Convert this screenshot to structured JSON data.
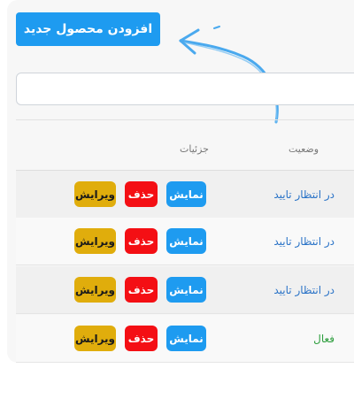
{
  "colors": {
    "primary": "#1e9bf0",
    "danger": "#f40f14",
    "warning": "#e0ad0c",
    "link": "#2a73c7",
    "success": "#2e9e3e",
    "arrow": "#4aa9ee"
  },
  "toolbar": {
    "add_label": "افزودن محصول جدید"
  },
  "search": {
    "value": "",
    "placeholder": ""
  },
  "table": {
    "headers": {
      "status": "وضعیت",
      "details": "جزئیات"
    },
    "rows": [
      {
        "status": "در انتظار تایید",
        "status_color": "#2a73c7",
        "view": "نمایش",
        "delete": "حذف",
        "edit": "ویرایش"
      },
      {
        "status": "در انتظار تایید",
        "status_color": "#2a73c7",
        "view": "نمایش",
        "delete": "حذف",
        "edit": "ویرایش"
      },
      {
        "status": "در انتظار تایید",
        "status_color": "#2a73c7",
        "view": "نمایش",
        "delete": "حذف",
        "edit": "ویرایش"
      },
      {
        "status": "فعال",
        "status_color": "#2e9e3e",
        "view": "نمایش",
        "delete": "حذف",
        "edit": "ویرایش"
      }
    ]
  },
  "annotation": {
    "icon": "hand-drawn-arrow-icon"
  }
}
